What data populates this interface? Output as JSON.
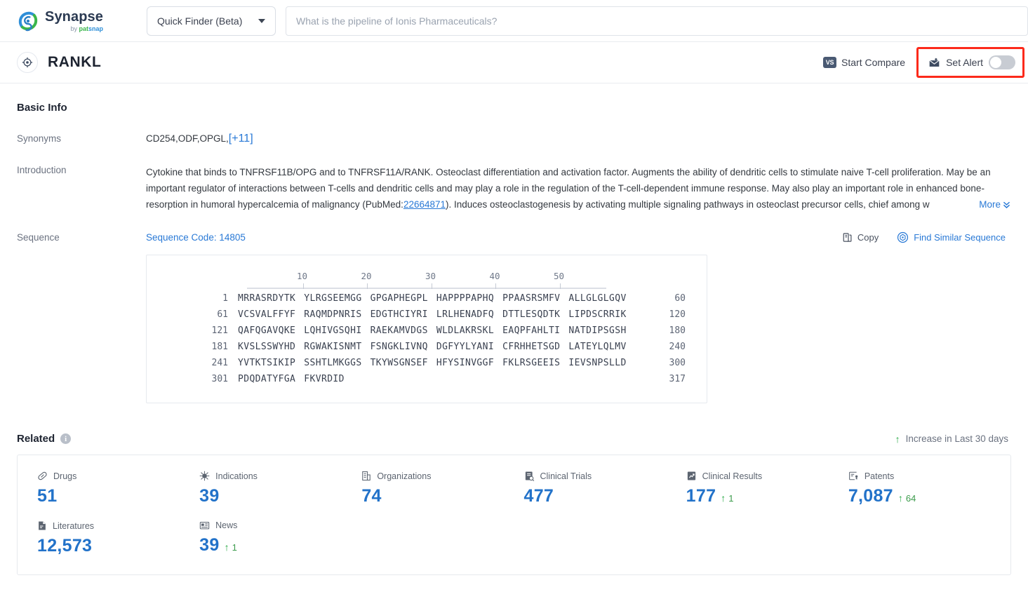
{
  "brand": {
    "name": "Synapse",
    "by_prefix": "by ",
    "by_part1": "pat",
    "by_part2": "snap",
    "logo_icon": "synapse-swirl-logo",
    "color_blue": "#2f8fd8",
    "color_green": "#3ab54a",
    "color_navy": "#2b3a52"
  },
  "topbar": {
    "finder": {
      "label": "Quick Finder (Beta)",
      "caret_icon": "chevron-down-icon"
    },
    "search": {
      "placeholder": "What is the pipeline of Ionis Pharmaceuticals?",
      "value": "",
      "icon": "search-input"
    }
  },
  "titlebar": {
    "target_icon": "target-crosshair-icon",
    "title": "RANKL",
    "compare": {
      "badge": "VS",
      "label": "Start Compare",
      "icon": "versus-badge-icon"
    },
    "alert": {
      "label": "Set Alert",
      "icon": "alert-envelope-icon",
      "toggle_state": "off",
      "highlight_color": "#fc2a1b"
    }
  },
  "basic_info": {
    "heading": "Basic Info",
    "synonyms": {
      "label": "Synonyms",
      "value": "CD254,ODF,OPGL,",
      "more_link": "[+11]"
    },
    "introduction": {
      "label": "Introduction",
      "text_part1": "Cytokine that binds to TNFRSF11B/OPG and to TNFRSF11A/RANK. Osteoclast differentiation and activation factor. Augments the ability of dendritic cells to stimulate naive T-cell proliferation. May be an important regulator of interactions between T-cells and dendritic cells and may play a role in the regulation of the T-cell-dependent immune response. May also play an important role in enhanced bone-resorption in humoral hypercalcemia of malignancy (PubMed:",
      "pubmed_link": "22664871",
      "text_part2": "). Induces osteoclastogenesis by activating multiple signaling pathways in osteoclast precursor cells, chief among w",
      "more_label": "More",
      "more_icon": "chevron-double-down-icon"
    },
    "sequence": {
      "label": "Sequence",
      "code_label": "Sequence Code: 14805",
      "copy_label": "Copy",
      "copy_icon": "copy-icon",
      "similar_label": "Find Similar Sequence",
      "similar_icon": "find-similar-sequence-icon",
      "ruler_ticks": [
        10,
        20,
        30,
        40,
        50
      ],
      "rows": [
        {
          "start": "1",
          "chunks": [
            "MRRASRDYTK",
            "YLRGSEEMGG",
            "GPGAPHEGPL",
            "HAPPPPAPHQ",
            "PPAASRSMFV",
            "ALLGLGLGQV"
          ],
          "end": "60"
        },
        {
          "start": "61",
          "chunks": [
            "VCSVALFFYF",
            "RAQMDPNRIS",
            "EDGTHCIYRI",
            "LRLHENADFQ",
            "DTTLESQDTK",
            "LIPDSCRRIK"
          ],
          "end": "120"
        },
        {
          "start": "121",
          "chunks": [
            "QAFQGAVQKE",
            "LQHIVGSQHI",
            "RAEKAMVDGS",
            "WLDLAKRSKL",
            "EAQPFAHLTI",
            "NATDIPSGSH"
          ],
          "end": "180"
        },
        {
          "start": "181",
          "chunks": [
            "KVSLSSWYHD",
            "RGWAKISNMT",
            "FSNGKLIVNQ",
            "DGFYYLYANI",
            "CFRHHETSGD",
            "LATEYLQLMV"
          ],
          "end": "240"
        },
        {
          "start": "241",
          "chunks": [
            "YVTKTSIKIP",
            "SSHTLMKGGS",
            "TKYWSGNSEF",
            "HFYSINVGGF",
            "FKLRSGEEIS",
            "IEVSNPSLLD"
          ],
          "end": "300"
        },
        {
          "start": "301",
          "chunks": [
            "PDQDATYFGA",
            "FKVRDID"
          ],
          "end": "317"
        }
      ]
    }
  },
  "related": {
    "heading": "Related",
    "info_icon": "info-icon",
    "legend": {
      "arrow_icon": "arrow-up-icon",
      "label": "Increase in Last 30 days"
    },
    "stats": [
      {
        "label": "Drugs",
        "icon": "pill-icon",
        "value": "51",
        "delta": ""
      },
      {
        "label": "Indications",
        "icon": "virus-icon",
        "value": "39",
        "delta": ""
      },
      {
        "label": "Organizations",
        "icon": "building-icon",
        "value": "74",
        "delta": ""
      },
      {
        "label": "Clinical Trials",
        "icon": "clinical-trial-icon",
        "value": "477",
        "delta": ""
      },
      {
        "label": "Clinical Results",
        "icon": "clinical-result-icon",
        "value": "177",
        "delta": "1"
      },
      {
        "label": "Patents",
        "icon": "patent-icon",
        "value": "7,087",
        "delta": "64"
      },
      {
        "label": "Literatures",
        "icon": "literature-icon",
        "value": "12,573",
        "delta": ""
      },
      {
        "label": "News",
        "icon": "news-icon",
        "value": "39",
        "delta": "1"
      }
    ]
  }
}
